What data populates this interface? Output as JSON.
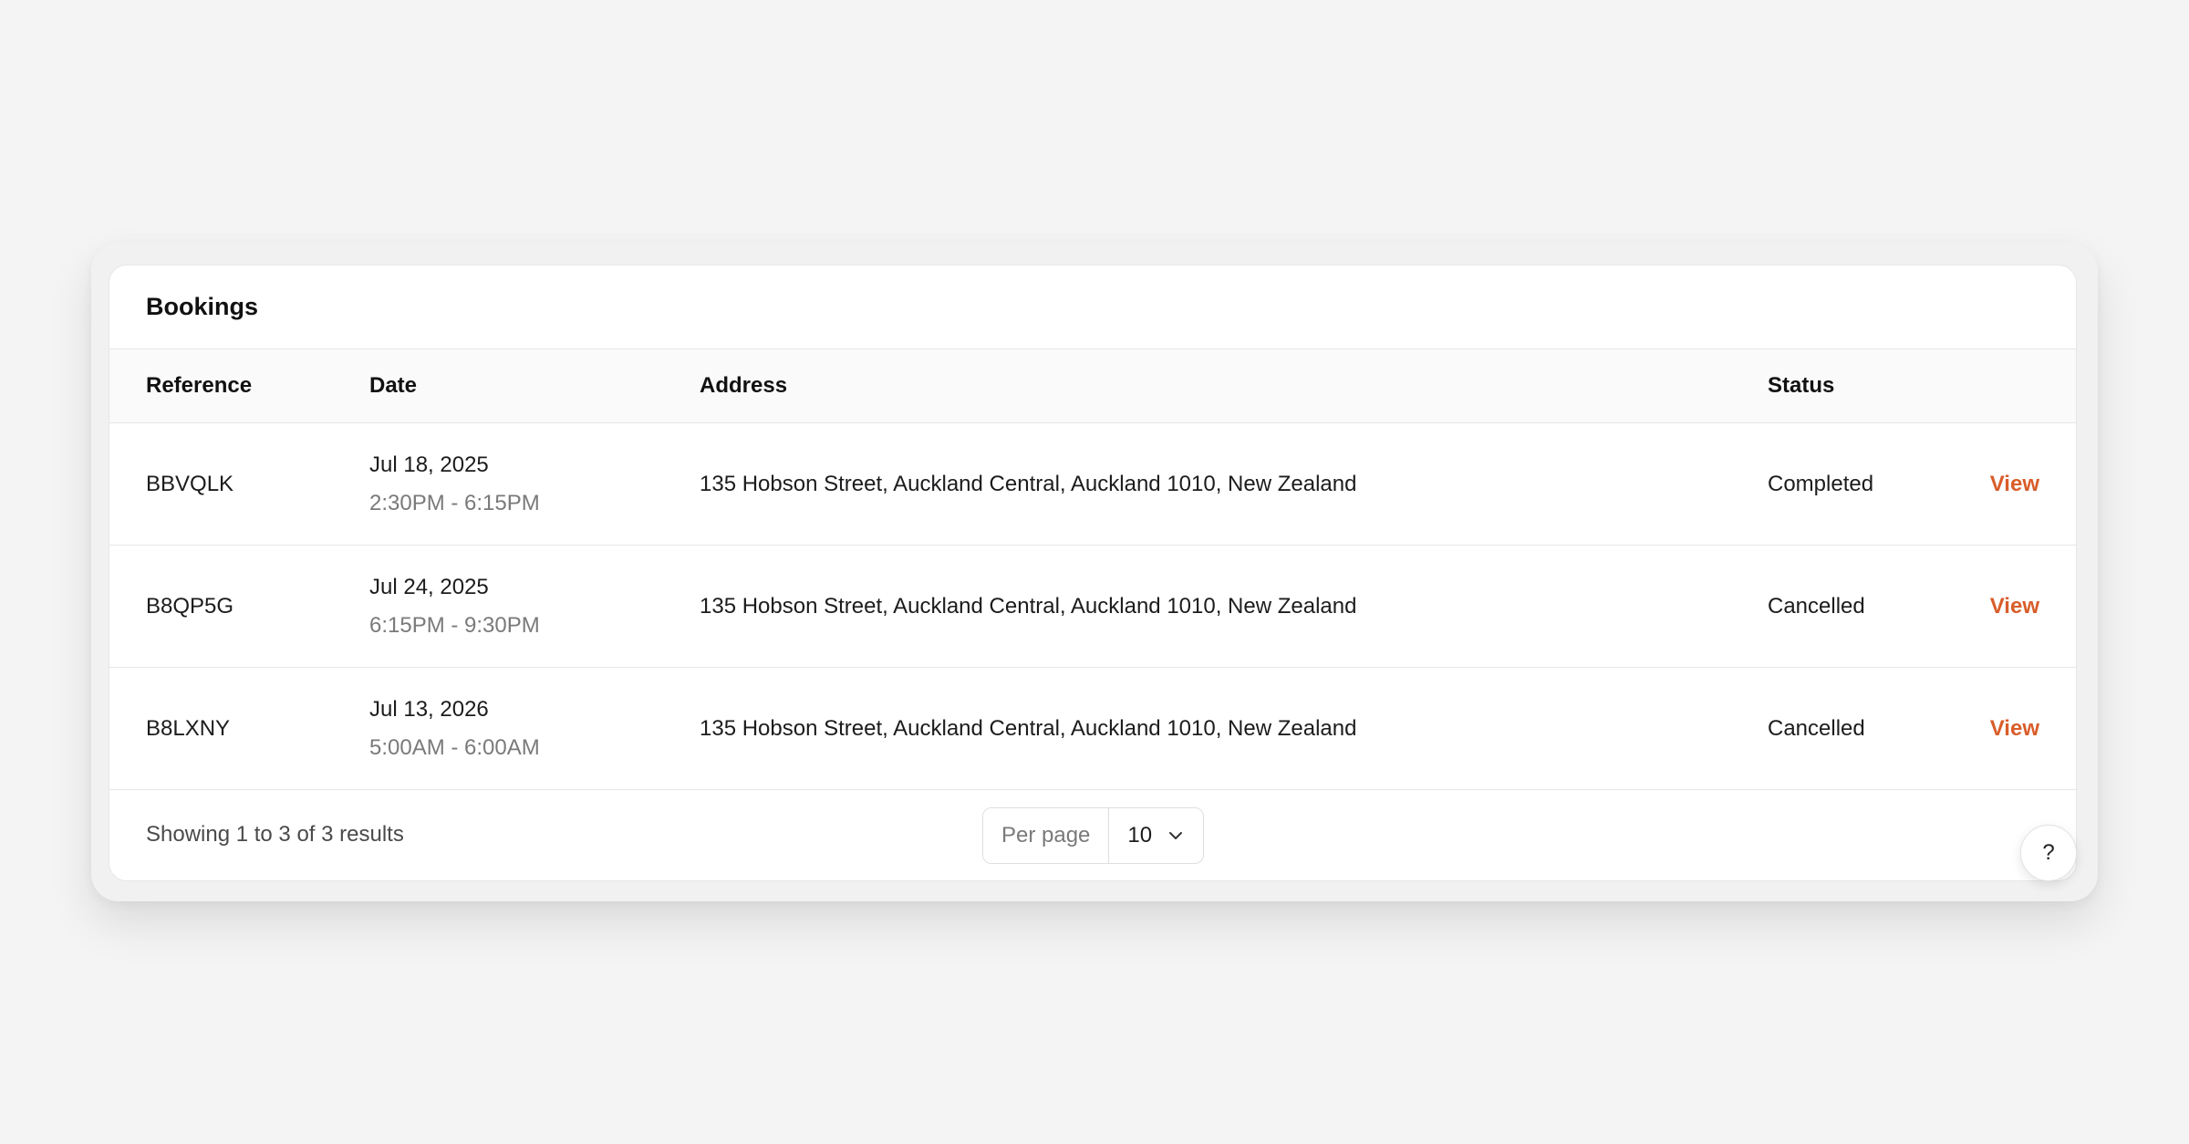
{
  "card": {
    "title": "Bookings"
  },
  "table": {
    "columns": {
      "reference": "Reference",
      "date": "Date",
      "address": "Address",
      "status": "Status"
    },
    "rows": [
      {
        "reference": "BBVQLK",
        "date": "Jul 18, 2025",
        "time": "2:30PM - 6:15PM",
        "address": "135 Hobson Street, Auckland Central, Auckland 1010, New Zealand",
        "status": "Completed",
        "action": "View"
      },
      {
        "reference": "B8QP5G",
        "date": "Jul 24, 2025",
        "time": "6:15PM - 9:30PM",
        "address": "135 Hobson Street, Auckland Central, Auckland 1010, New Zealand",
        "status": "Cancelled",
        "action": "View"
      },
      {
        "reference": "B8LXNY",
        "date": "Jul 13, 2026",
        "time": "5:00AM - 6:00AM",
        "address": "135 Hobson Street, Auckland Central, Auckland 1010, New Zealand",
        "status": "Cancelled",
        "action": "View"
      }
    ]
  },
  "footer": {
    "results_text": "Showing 1 to 3 of 3 results",
    "per_page_label": "Per page",
    "per_page_value": "10"
  },
  "help": {
    "label": "?"
  },
  "colors": {
    "accent": "#d95d2a",
    "background": "#f4f4f4",
    "muted_text": "#7a7a7a"
  },
  "icons": {
    "per_page_dropdown": "chevron-down-icon"
  }
}
